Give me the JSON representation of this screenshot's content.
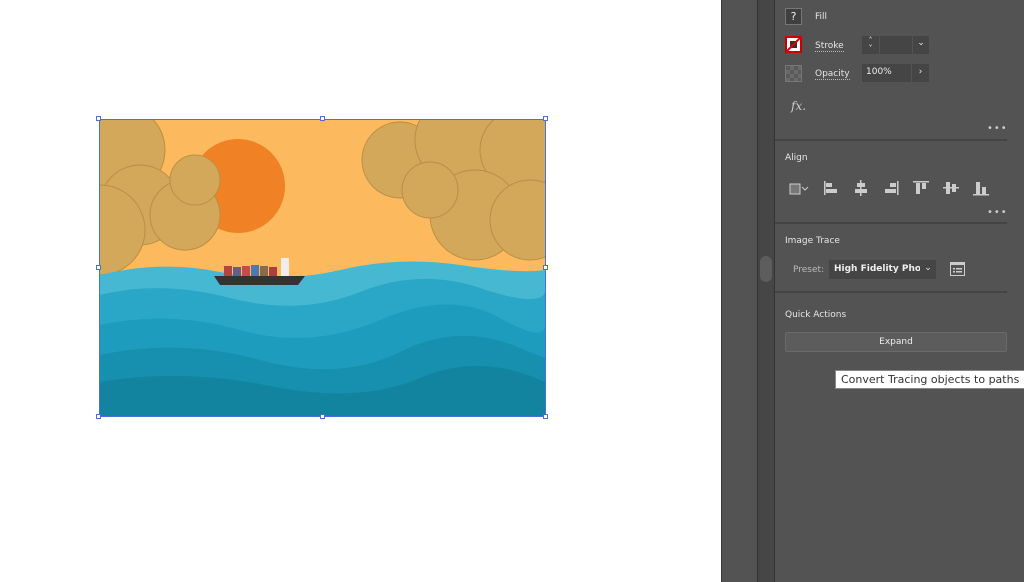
{
  "properties": {
    "fill_label": "Fill",
    "fill_icon": "unknown-fill-icon",
    "stroke_label": "Stroke",
    "stroke_value": "",
    "opacity_label": "Opacity",
    "opacity_value": "100%",
    "fx_label": "fx.",
    "more": "•••"
  },
  "align": {
    "title": "Align",
    "more": "•••",
    "icons": [
      "align-to-selection-icon",
      "align-left-icon",
      "align-horizontal-center-icon",
      "align-right-icon",
      "align-top-icon",
      "align-vertical-center-icon",
      "align-bottom-icon"
    ]
  },
  "image_trace": {
    "title": "Image Trace",
    "preset_label": "Preset:",
    "preset_value": "High Fidelity Photo",
    "panel_icon": "image-trace-panel-icon"
  },
  "quick_actions": {
    "title": "Quick Actions",
    "expand_label": "Expand"
  },
  "tooltip": "Convert Tracing objects to paths",
  "colors": {
    "sky": "#fdb95d",
    "sun": "#f08125",
    "cloud": "#d3a85a",
    "sea": "#1a9ab8",
    "panel": "#535353"
  }
}
